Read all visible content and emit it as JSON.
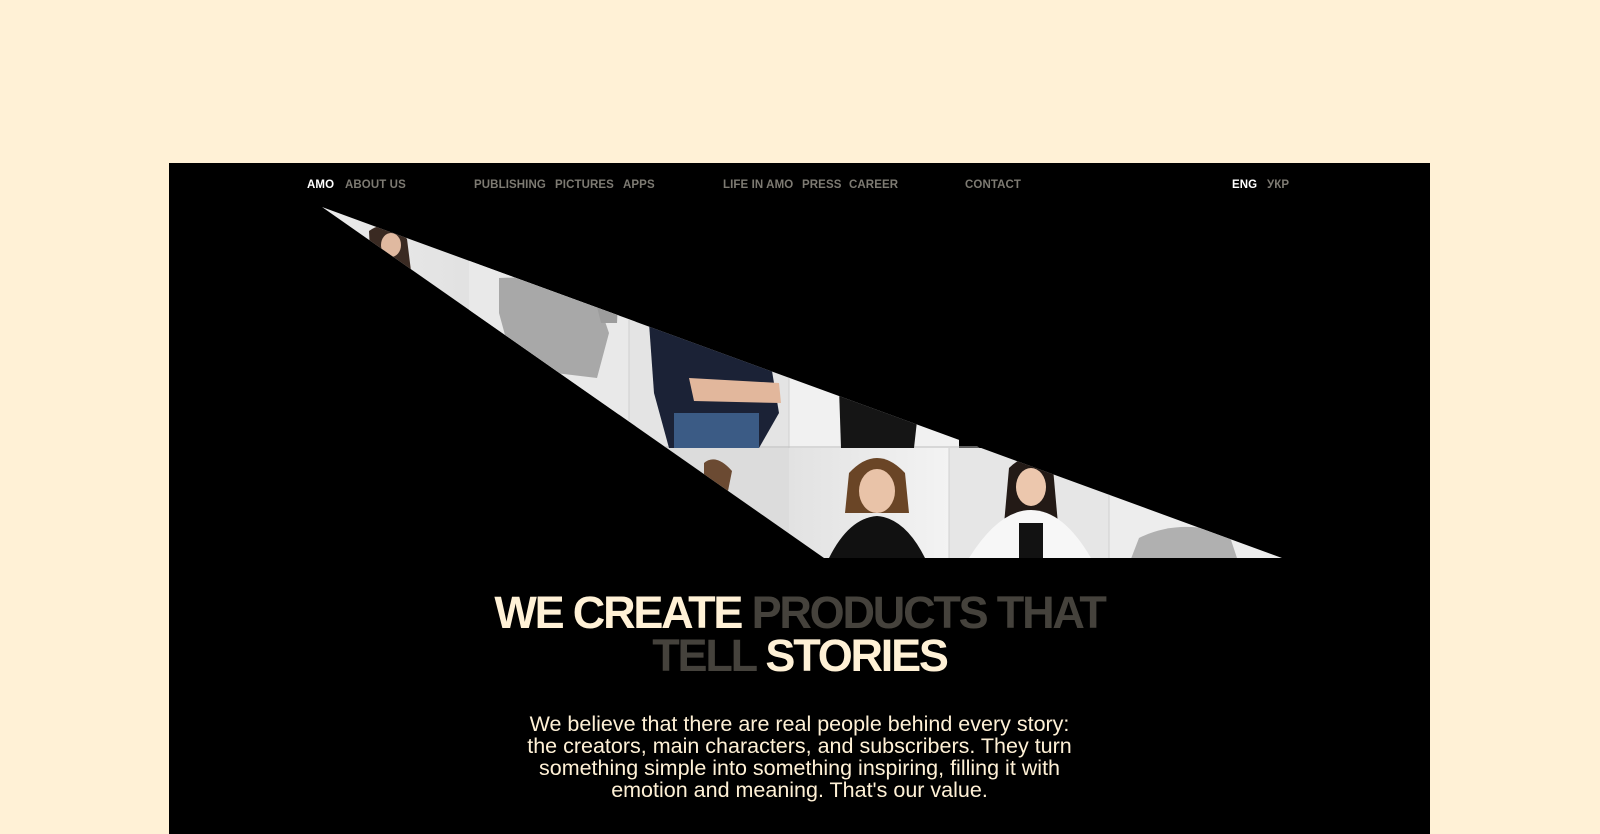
{
  "nav": {
    "brand": "AMO",
    "about": "ABOUT US",
    "publishing": "PUBLISHING",
    "pictures": "PICTURES",
    "apps": "APPS",
    "life": "LIFE IN AMO",
    "press": "PRESS",
    "career": "CAREER",
    "contact": "CONTACT",
    "lang_en": "ENG",
    "lang_ua": "УКР"
  },
  "hero": {
    "headline": {
      "part1": "WE CREATE",
      "part2": "PRODUCTS THAT",
      "part3": "TELL",
      "part4": "STORIES"
    },
    "lead_lines": [
      "We believe that there are real people behind every story:",
      "the creators, main characters, and subscribers. They turn",
      "something simple into something inspiring, filling it with",
      "emotion and meaning. That's our value."
    ]
  },
  "colors": {
    "page_bg": "#fff1d6",
    "frame_bg": "#000000",
    "accent_cream": "#fff1d6",
    "muted_grey": "#45423c",
    "nav_muted": "#7d7a72"
  }
}
